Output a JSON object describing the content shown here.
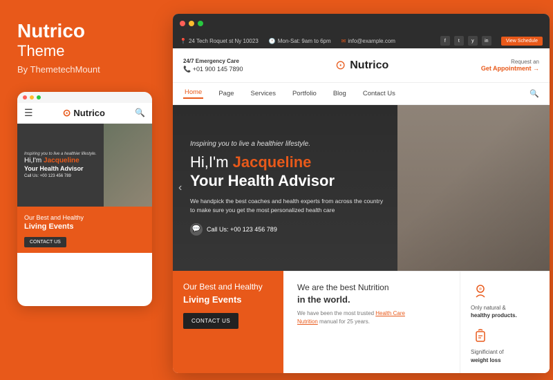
{
  "left": {
    "brand_name": "Nutrico",
    "brand_subtitle": "Theme",
    "brand_by": "By ThemetechMount",
    "mobile_logo": "Nutrico",
    "mobile_inspiring": "Inspiring you to live a healthier lifestyle.",
    "mobile_hi": "Hi,I'm",
    "mobile_name": "Jacqueline",
    "mobile_advisor": "Your Health Advisor",
    "mobile_call": "Call Us: +00 123 456 789",
    "mobile_events_title": "Our Best and Healthy",
    "mobile_events_living": "Living Events",
    "mobile_contact_btn": "CONTACT US"
  },
  "topbar": {
    "address": "24 Tech Roquet st Ny 10023",
    "hours": "Mon-Sat: 9am to 6pm",
    "email": "info@example.com",
    "schedule_btn": "View Schedule",
    "social_fb": "f",
    "social_tw": "t",
    "social_yt": "y",
    "social_in": "in"
  },
  "header": {
    "emergency_title": "24/7 Emergency Care",
    "emergency_phone": "+01 900 145 7890",
    "logo_text": "Nutrico",
    "request_label": "Request an",
    "appointment_label": "Get Appointment →"
  },
  "nav": {
    "items": [
      "Home",
      "Page",
      "Services",
      "Portfolio",
      "Blog",
      "Contact Us"
    ],
    "active_item": "Home"
  },
  "hero": {
    "inspiring": "Inspiring you to live a healthier lifestyle.",
    "hi_prefix": "Hi,I'm",
    "name": "Jacqueline",
    "advisor": "Your Health Advisor",
    "description": "We handpick the best coaches and health experts from across the country to make sure you get the most personalized health care",
    "call_label": "Call Us: +00 123 456 789"
  },
  "bottom": {
    "events_title": "Our Best and Healthy",
    "events_living": "Living Events",
    "contact_btn": "CONTACT US",
    "nutrition_title": "We are the best Nutrition",
    "nutrition_bold": "in the world.",
    "nutrition_desc": "We have been the most trusted Health Care Nutrition manual for 25 years.",
    "icon1_label": "Only natural &",
    "icon1_sublabel": "healthy products.",
    "icon2_label": "Significiant of",
    "icon2_sublabel": "weight loss"
  },
  "colors": {
    "accent": "#E8591A",
    "dark": "#2d2d2d",
    "white": "#ffffff"
  }
}
